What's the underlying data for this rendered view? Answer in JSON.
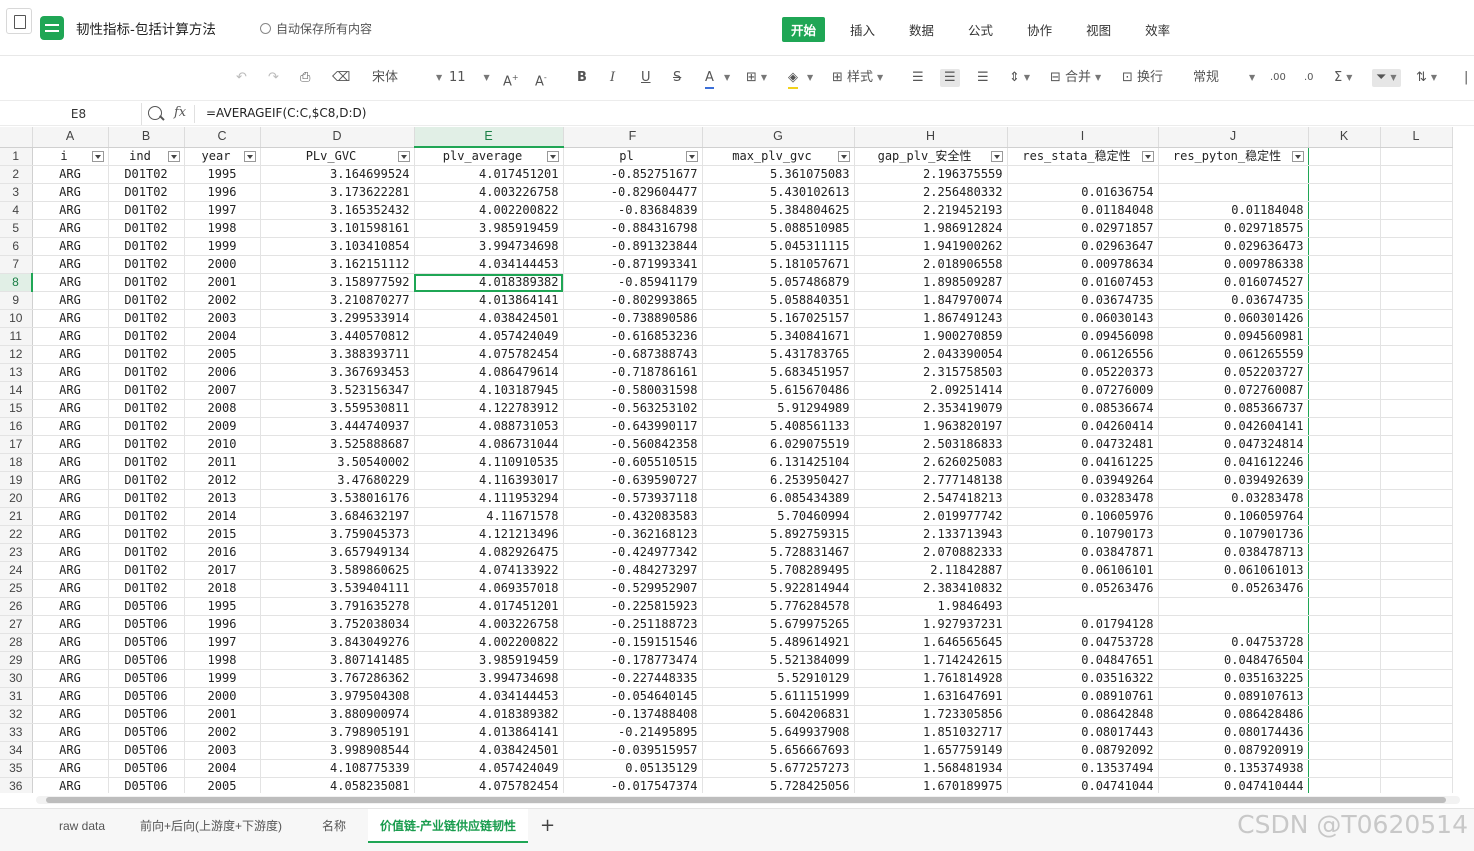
{
  "titlebar": {
    "doc_title": "韧性指标-包括计算方法",
    "autosave": "自动保存所有内容",
    "menu": [
      "开始",
      "插入",
      "数据",
      "公式",
      "协作",
      "视图",
      "效率"
    ]
  },
  "toolbar": {
    "font_name": "宋体",
    "font_size": "11",
    "style_label": "样式",
    "merge_label": "合并",
    "wrap_label": "换行",
    "number_format": "常规"
  },
  "formula_bar": {
    "cell_ref": "E8",
    "formula": "=AVERAGEIF(C:C,$C8,D:D)"
  },
  "columns": [
    "A",
    "B",
    "C",
    "D",
    "E",
    "F",
    "G",
    "H",
    "I",
    "J",
    "K",
    "L"
  ],
  "selected_column": "E",
  "selected_row": 8,
  "header_row": [
    "i",
    "ind",
    "year",
    "PLv_GVC",
    "plv_average",
    "pl",
    "max_plv_gvc",
    "gap_plv_安全性",
    "res_stata_稳定性",
    "res_pyton_稳定性"
  ],
  "rows": [
    [
      "ARG",
      "D01T02",
      "1995",
      "3.164699524",
      "4.017451201",
      "-0.852751677",
      "5.361075083",
      "2.196375559",
      "",
      ""
    ],
    [
      "ARG",
      "D01T02",
      "1996",
      "3.173622281",
      "4.003226758",
      "-0.829604477",
      "5.430102613",
      "2.256480332",
      "0.01636754",
      ""
    ],
    [
      "ARG",
      "D01T02",
      "1997",
      "3.165352432",
      "4.002200822",
      "-0.83684839",
      "5.384804625",
      "2.219452193",
      "0.01184048",
      "0.01184048"
    ],
    [
      "ARG",
      "D01T02",
      "1998",
      "3.101598161",
      "3.985919459",
      "-0.884316798",
      "5.088510985",
      "1.986912824",
      "0.02971857",
      "0.029718575"
    ],
    [
      "ARG",
      "D01T02",
      "1999",
      "3.103410854",
      "3.994734698",
      "-0.891323844",
      "5.045311115",
      "1.941900262",
      "0.02963647",
      "0.029636473"
    ],
    [
      "ARG",
      "D01T02",
      "2000",
      "3.162151112",
      "4.034144453",
      "-0.871993341",
      "5.181057671",
      "2.018906558",
      "0.00978634",
      "0.009786338"
    ],
    [
      "ARG",
      "D01T02",
      "2001",
      "3.158977592",
      "4.018389382",
      "-0.85941179",
      "5.057486879",
      "1.898509287",
      "0.01607453",
      "0.016074527"
    ],
    [
      "ARG",
      "D01T02",
      "2002",
      "3.210870277",
      "4.013864141",
      "-0.802993865",
      "5.058840351",
      "1.847970074",
      "0.03674735",
      "0.03674735"
    ],
    [
      "ARG",
      "D01T02",
      "2003",
      "3.299533914",
      "4.038424501",
      "-0.738890586",
      "5.167025157",
      "1.867491243",
      "0.06030143",
      "0.060301426"
    ],
    [
      "ARG",
      "D01T02",
      "2004",
      "3.440570812",
      "4.057424049",
      "-0.616853236",
      "5.340841671",
      "1.900270859",
      "0.09456098",
      "0.094560981"
    ],
    [
      "ARG",
      "D01T02",
      "2005",
      "3.388393711",
      "4.075782454",
      "-0.687388743",
      "5.431783765",
      "2.043390054",
      "0.06126556",
      "0.061265559"
    ],
    [
      "ARG",
      "D01T02",
      "2006",
      "3.367693453",
      "4.086479614",
      "-0.718786161",
      "5.683451957",
      "2.315758503",
      "0.05220373",
      "0.052203727"
    ],
    [
      "ARG",
      "D01T02",
      "2007",
      "3.523156347",
      "4.103187945",
      "-0.580031598",
      "5.615670486",
      "2.09251414",
      "0.07276009",
      "0.072760087"
    ],
    [
      "ARG",
      "D01T02",
      "2008",
      "3.559530811",
      "4.122783912",
      "-0.563253102",
      "5.91294989",
      "2.353419079",
      "0.08536674",
      "0.085366737"
    ],
    [
      "ARG",
      "D01T02",
      "2009",
      "3.444740937",
      "4.088731053",
      "-0.643990117",
      "5.408561133",
      "1.963820197",
      "0.04260414",
      "0.042604141"
    ],
    [
      "ARG",
      "D01T02",
      "2010",
      "3.525888687",
      "4.086731044",
      "-0.560842358",
      "6.029075519",
      "2.503186833",
      "0.04732481",
      "0.047324814"
    ],
    [
      "ARG",
      "D01T02",
      "2011",
      "3.50540002",
      "4.110910535",
      "-0.605510515",
      "6.131425104",
      "2.626025083",
      "0.04161225",
      "0.041612246"
    ],
    [
      "ARG",
      "D01T02",
      "2012",
      "3.47680229",
      "4.116393017",
      "-0.639590727",
      "6.253950427",
      "2.777148138",
      "0.03949264",
      "0.039492639"
    ],
    [
      "ARG",
      "D01T02",
      "2013",
      "3.538016176",
      "4.111953294",
      "-0.573937118",
      "6.085434389",
      "2.547418213",
      "0.03283478",
      "0.03283478"
    ],
    [
      "ARG",
      "D01T02",
      "2014",
      "3.684632197",
      "4.11671578",
      "-0.432083583",
      "5.70460994",
      "2.019977742",
      "0.10605976",
      "0.106059764"
    ],
    [
      "ARG",
      "D01T02",
      "2015",
      "3.759045373",
      "4.121213496",
      "-0.362168123",
      "5.892759315",
      "2.133713943",
      "0.10790173",
      "0.107901736"
    ],
    [
      "ARG",
      "D01T02",
      "2016",
      "3.657949134",
      "4.082926475",
      "-0.424977342",
      "5.728831467",
      "2.070882333",
      "0.03847871",
      "0.038478713"
    ],
    [
      "ARG",
      "D01T02",
      "2017",
      "3.589860625",
      "4.074133922",
      "-0.484273297",
      "5.708289495",
      "2.11842887",
      "0.06106101",
      "0.061061013"
    ],
    [
      "ARG",
      "D01T02",
      "2018",
      "3.539404111",
      "4.069357018",
      "-0.529952907",
      "5.922814944",
      "2.383410832",
      "0.05263476",
      "0.05263476"
    ],
    [
      "ARG",
      "D05T06",
      "1995",
      "3.791635278",
      "4.017451201",
      "-0.225815923",
      "5.776284578",
      "1.9846493",
      "",
      ""
    ],
    [
      "ARG",
      "D05T06",
      "1996",
      "3.752038034",
      "4.003226758",
      "-0.251188723",
      "5.679975265",
      "1.927937231",
      "0.01794128",
      ""
    ],
    [
      "ARG",
      "D05T06",
      "1997",
      "3.843049276",
      "4.002200822",
      "-0.159151546",
      "5.489614921",
      "1.646565645",
      "0.04753728",
      "0.04753728"
    ],
    [
      "ARG",
      "D05T06",
      "1998",
      "3.807141485",
      "3.985919459",
      "-0.178773474",
      "5.521384099",
      "1.714242615",
      "0.04847651",
      "0.048476504"
    ],
    [
      "ARG",
      "D05T06",
      "1999",
      "3.767286362",
      "3.994734698",
      "-0.227448335",
      "5.52910129",
      "1.761814928",
      "0.03516322",
      "0.035163225"
    ],
    [
      "ARG",
      "D05T06",
      "2000",
      "3.979504308",
      "4.034144453",
      "-0.054640145",
      "5.611151999",
      "1.631647691",
      "0.08910761",
      "0.089107613"
    ],
    [
      "ARG",
      "D05T06",
      "2001",
      "3.880900974",
      "4.018389382",
      "-0.137488408",
      "5.604206831",
      "1.723305856",
      "0.08642848",
      "0.086428486"
    ],
    [
      "ARG",
      "D05T06",
      "2002",
      "3.798905191",
      "4.013864141",
      "-0.21495895",
      "5.649937908",
      "1.851032717",
      "0.08017443",
      "0.080174436"
    ],
    [
      "ARG",
      "D05T06",
      "2003",
      "3.998908544",
      "4.038424501",
      "-0.039515957",
      "5.656667693",
      "1.657759149",
      "0.08792092",
      "0.087920919"
    ],
    [
      "ARG",
      "D05T06",
      "2004",
      "4.108775339",
      "4.057424049",
      "0.05135129",
      "5.677257273",
      "1.568481934",
      "0.13537494",
      "0.135374938"
    ],
    [
      "ARG",
      "D05T06",
      "2005",
      "4.058235081",
      "4.075782454",
      "-0.017547374",
      "5.728425056",
      "1.670189975",
      "0.04741044",
      "0.047410444"
    ]
  ],
  "sheet_tabs": [
    "raw data",
    "前向+后向(上游度+下游度)",
    "名称",
    "价值链-产业链供应链韧性"
  ],
  "active_sheet": 3,
  "watermark": "CSDN @T0620514",
  "colors": {
    "accent": "#1fa655"
  }
}
